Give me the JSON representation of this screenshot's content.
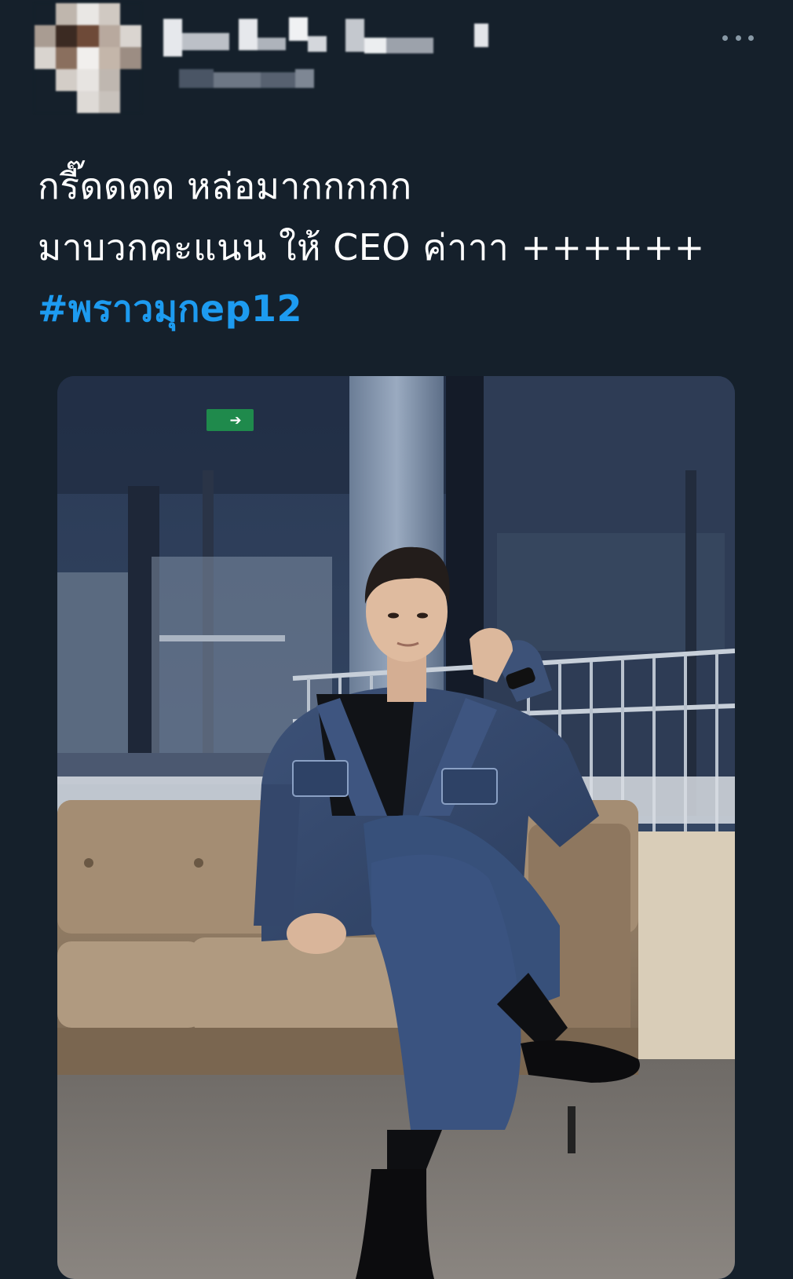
{
  "tweet": {
    "text_line_1": "กรี๊ดดดด หล่อมากกกกก",
    "text_line_2": "มาบวกคะแนน ให้ CEO ค่าาา ++++++",
    "hashtag": "#พราวมุกep12"
  },
  "icons": {
    "more": "more-horizontal-icon"
  },
  "colors": {
    "background": "#15202b",
    "text": "#ffffff",
    "hashtag": "#1d9bf0",
    "muted_icon": "#8899a6"
  },
  "media": {
    "exit_sign_arrow": "➔"
  }
}
